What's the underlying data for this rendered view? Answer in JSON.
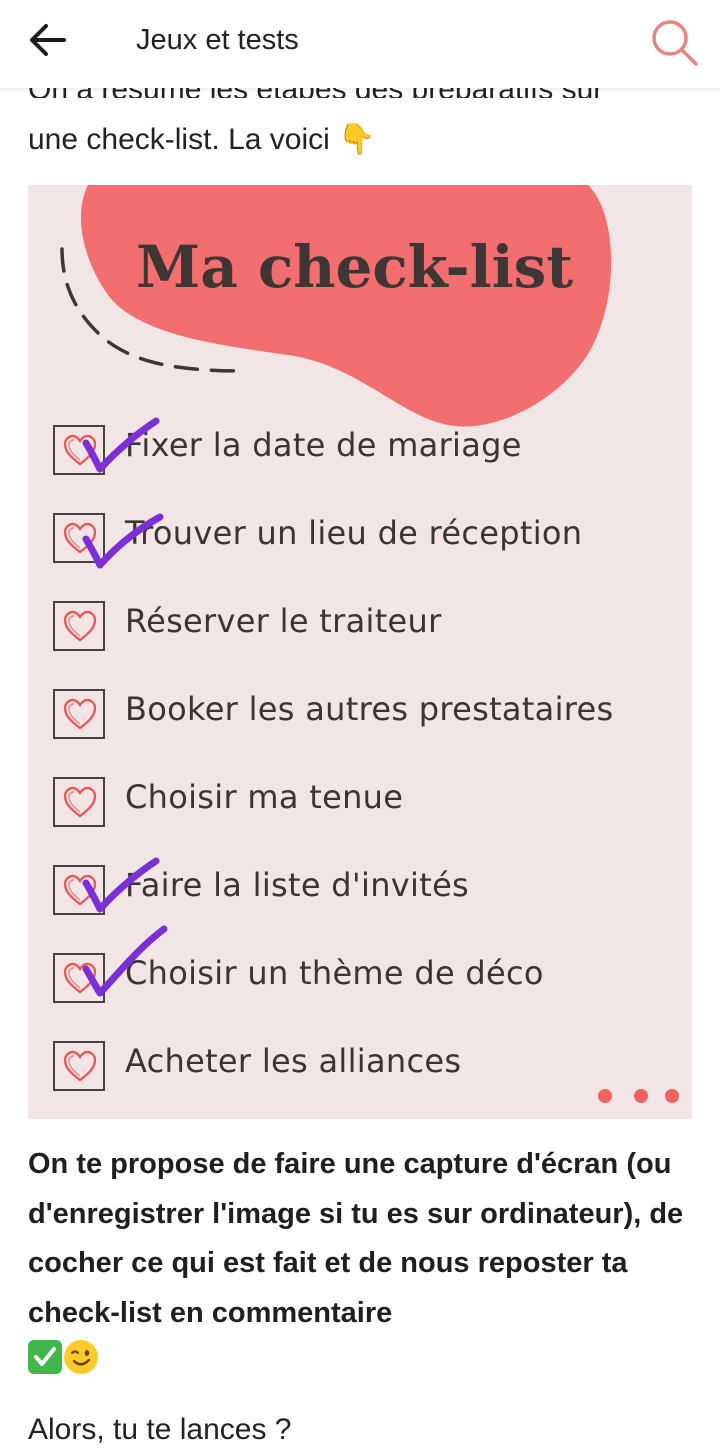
{
  "header": {
    "title": "Jeux et tests",
    "back_icon": "arrow-left-icon",
    "search_icon": "search-icon"
  },
  "post": {
    "cut_line": "On a résumé les étapes des préparatifs sur",
    "intro": "une check-list. La voici",
    "intro_emoji": "👇",
    "card": {
      "title": "Ma check-list",
      "items": [
        {
          "label": "Fixer la date de mariage",
          "checked": true
        },
        {
          "label": "Trouver un lieu de réception",
          "checked": true
        },
        {
          "label": "Réserver le traiteur",
          "checked": false
        },
        {
          "label": "Booker les autres prestataires",
          "checked": false
        },
        {
          "label": "Choisir ma tenue",
          "checked": false
        },
        {
          "label": "Faire la liste d'invités",
          "checked": true
        },
        {
          "label": "Choisir un thème de déco",
          "checked": true
        },
        {
          "label": "Acheter les alliances",
          "checked": false
        }
      ]
    },
    "paragraph": "On te propose de faire une capture d'écran (ou d'enregistrer l'image si tu es sur ordinateur), de cocher ce qui est fait et de nous reposter ta check-list en commentaire",
    "paragraph_emojis": [
      "✅",
      "😉"
    ],
    "final": "Alors, tu te lances ?"
  },
  "colors": {
    "accent": "#e8847d",
    "blob": "#f36e6e",
    "card_bg": "#f1e6e5",
    "tick": "#7b2fd6",
    "heart": "#ea5a5a"
  }
}
